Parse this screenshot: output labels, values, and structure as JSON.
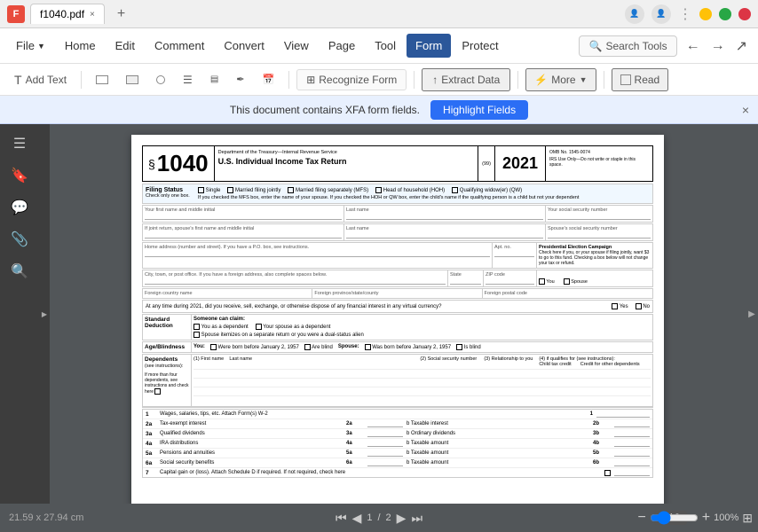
{
  "titlebar": {
    "app_icon": "F",
    "tab_name": "f1040.pdf",
    "close_label": "×",
    "new_tab_label": "+",
    "win_minimize": "–",
    "win_maximize": "□",
    "win_close": "×"
  },
  "menubar": {
    "file_label": "File",
    "items": [
      {
        "id": "home",
        "label": "Home",
        "active": false
      },
      {
        "id": "edit",
        "label": "Edit",
        "active": false
      },
      {
        "id": "comment",
        "label": "Comment",
        "active": false
      },
      {
        "id": "convert",
        "label": "Convert",
        "active": false
      },
      {
        "id": "view",
        "label": "View",
        "active": false
      },
      {
        "id": "page",
        "label": "Page",
        "active": false
      },
      {
        "id": "tool",
        "label": "Tool",
        "active": false
      },
      {
        "id": "form",
        "label": "Form",
        "active": true
      },
      {
        "id": "protect",
        "label": "Protect",
        "active": false
      }
    ],
    "search_placeholder": "Search Tools"
  },
  "actionbar": {
    "add_text": "Add Text",
    "recognize": "Recognize Form",
    "extract_data": "Extract Data",
    "more": "More",
    "read": "Read"
  },
  "xfa_banner": {
    "message": "This document contains XFA form fields.",
    "highlight_btn": "Highlight Fields",
    "close": "×"
  },
  "left_sidebar": {
    "icons": [
      "☰",
      "🔖",
      "💬",
      "📎",
      "🔍"
    ]
  },
  "pdf": {
    "form_number": "1040",
    "dept_label": "Department of the Treasury—Internal Revenue Service",
    "form_code": "(99)",
    "year": "2021",
    "omb": "OMB No. 1545-0074",
    "irs_note": "IRS Use Only—Do not write or staple in this space.",
    "title": "U.S. Individual Income Tax Return",
    "section_label": "§",
    "filing_status": "Filing Status",
    "check_note": "Check only one box.",
    "filing_options": [
      "Single",
      "Married filing jointly",
      "Married filing separately (MFS)",
      "Head of household (HOH)",
      "Qualifying widow(er) (QW)"
    ],
    "mfs_note": "If you checked the MFS box, enter the name of your spouse. If you checked the HOH or QW box, enter the child's name if the qualifying person is a child but not your dependent",
    "fields": {
      "first_name": "Your first name and middle initial",
      "last_name": "Last name",
      "ssn": "Your social security number",
      "joint_name": "If joint return, spouse's first name and middle initial",
      "joint_last": "Last name",
      "spouse_ssn": "Spouse's social security number",
      "address": "Home address (number and street). If you have a P.O. box, see instructions.",
      "apt": "Apt. no.",
      "pec": "Presidential Election Campaign",
      "pec_note": "Check here if you, or your spouse if filing jointly, want $3 to go to this fund. Checking a box below will not change your tax or refund.",
      "city": "City, town, or post office. If you have a foreign address, also complete spaces below.",
      "state": "State",
      "zip": "ZIP code",
      "foreign_country": "Foreign country name",
      "foreign_province": "Foreign province/state/county",
      "foreign_postal": "Foreign postal code"
    },
    "election_checkboxes": [
      "You",
      "Spouse"
    ],
    "virtual_currency": "At any time during 2021, did you receive, sell, exchange, or otherwise dispose of any financial interest in any virtual currency?",
    "yes_no": [
      "Yes",
      "No"
    ],
    "standard_deduction": {
      "label": "Standard Deduction",
      "someone_claim": "Someone can claim:",
      "you_dep": "You as a dependent",
      "spouse_dep": "Your spouse as a dependent",
      "spouse_itemize": "Spouse itemizes on a separate return or you were a dual-status alien"
    },
    "age_blindness": {
      "label": "Age/Blindness",
      "you": "You:",
      "born_before": "Were born before January 2, 1957",
      "are_blind": "Are blind",
      "spouse": "Spouse:",
      "spouse_born": "Was born before January 2, 1957",
      "spouse_blind": "Is blind"
    },
    "dependents": {
      "label": "Dependents",
      "see_instructions": "(see instructions):",
      "if_more": "If more than four dependents, see instructions and check here",
      "cols": [
        "(1) First name",
        "Last name",
        "(2) Social security number",
        "(3) Relationship to you",
        "(4) if qualifies for (see instructions):",
        "Child tax credit",
        "Credit for other dependents"
      ]
    },
    "income_lines": [
      {
        "num": "1",
        "desc": "Wages, salaries, tips, etc. Attach Form(s) W-2",
        "box_a": "1",
        "box_b": null
      },
      {
        "num": "2a",
        "desc": "Tax-exempt interest",
        "box_a": "2a",
        "box_b": "2b",
        "desc_b": "b  Taxable interest"
      },
      {
        "num": "3a",
        "desc": "Qualified dividends",
        "box_a": "3a",
        "box_b": "3b",
        "desc_b": "b  Ordinary dividends"
      },
      {
        "num": "4a",
        "desc": "IRA distributions",
        "box_a": "4a",
        "box_b": "4b",
        "desc_b": "b  Taxable amount"
      },
      {
        "num": "5a",
        "desc": "Pensions and annuities",
        "box_a": "5a",
        "box_b": "5b",
        "desc_b": "b  Taxable amount"
      },
      {
        "num": "6a",
        "desc": "Social security benefits",
        "box_a": "6a",
        "box_b": "6b",
        "desc_b": "b  Taxable amount"
      },
      {
        "num": "7",
        "desc": "Capital gain or (loss). Attach Schedule D if required. If not required, check here",
        "checkbox": true
      }
    ]
  },
  "bottom": {
    "page_current": "1",
    "page_total": "2",
    "page_display": "1 / 2",
    "zoom_level": "100%",
    "coordinates": "21.59 x 27.94 cm",
    "first_page": "⏮",
    "prev_page": "◀",
    "next_page": "▶",
    "last_page": "⏭",
    "zoom_minus": "−",
    "zoom_plus": "+"
  }
}
